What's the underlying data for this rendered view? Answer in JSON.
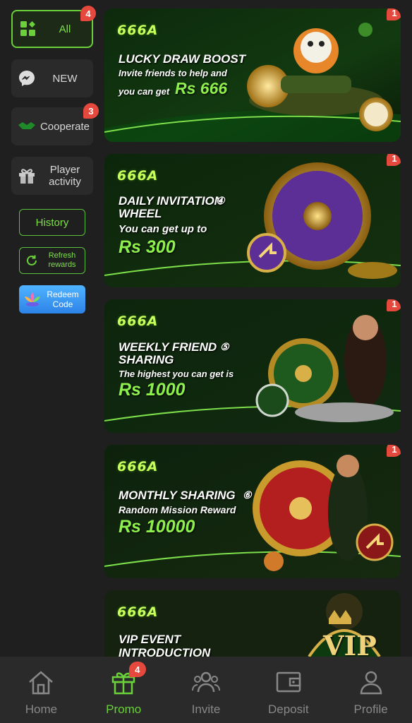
{
  "sidebar": {
    "categories": [
      {
        "label": "All",
        "badge": "4",
        "icon": "grid-icon"
      },
      {
        "label": "NEW",
        "icon": "messenger-icon"
      },
      {
        "label": "Cooperate",
        "badge": "3",
        "icon": "handshake-icon"
      },
      {
        "label": "Player activity",
        "icon": "gift-icon"
      }
    ],
    "history_label": "History",
    "refresh_label": "Refresh rewards",
    "redeem_label": "Redeem Code"
  },
  "banners": [
    {
      "brand": "666A",
      "title": "LUCKY DRAW BOOST",
      "subtitle": "Invite friends to help and",
      "subtitle2": "you can get",
      "amount": "Rs 666",
      "badge": "1"
    },
    {
      "brand": "666A",
      "title": "DAILY INVITATION",
      "title2": "WHEEL",
      "number": "④",
      "subtitle": "You can get up to",
      "amount": "Rs 300",
      "badge": "1"
    },
    {
      "brand": "666A",
      "title": "WEEKLY FRIEND",
      "title2": "SHARING",
      "number": "⑤",
      "subtitle": "The highest you can get is",
      "amount": "Rs 1000",
      "badge": "1"
    },
    {
      "brand": "666A",
      "title": "MONTHLY SHARING",
      "number": "⑥",
      "subtitle": "Random Mission Reward",
      "amount": "Rs 10000",
      "badge": "1"
    },
    {
      "brand": "666A",
      "title": "VIP EVENT",
      "title2": "INTRODUCTION",
      "logo_text": "VIP"
    }
  ],
  "bottom_nav": [
    {
      "label": "Home",
      "icon": "home-icon"
    },
    {
      "label": "Promo",
      "icon": "gift-icon",
      "badge": "4",
      "active": true
    },
    {
      "label": "Invite",
      "icon": "people-icon"
    },
    {
      "label": "Deposit",
      "icon": "wallet-icon"
    },
    {
      "label": "Profile",
      "icon": "user-icon"
    }
  ],
  "colors": {
    "accent": "#6ad13a",
    "badge": "#e5483d",
    "background": "#1f1f1f",
    "panel": "#2a2a2a"
  }
}
